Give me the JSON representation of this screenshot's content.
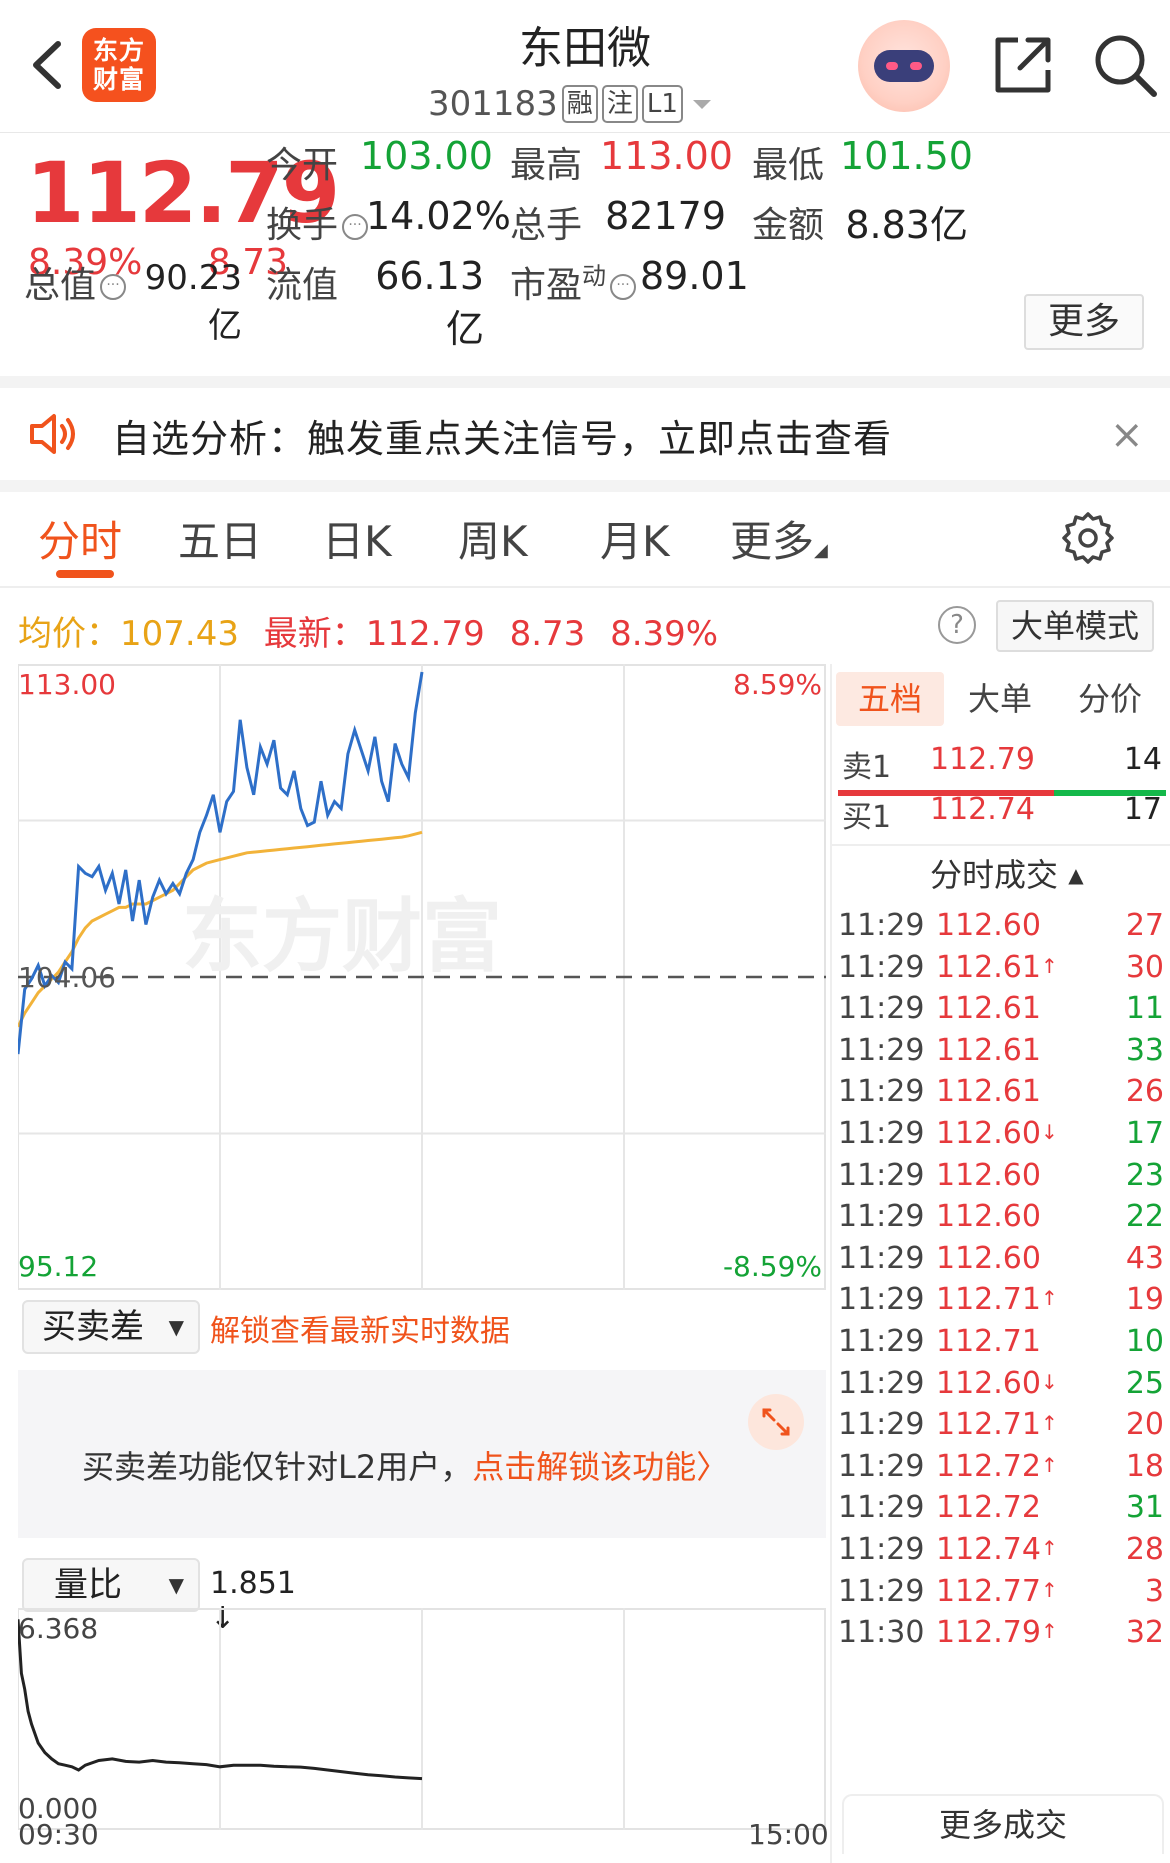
{
  "header": {
    "logo_text": "东方财富",
    "title": "东田微",
    "code": "301183",
    "tags": [
      "融",
      "注",
      "L1"
    ]
  },
  "quote": {
    "price": "112.79",
    "change_pct": "8.39%",
    "change": "8.73",
    "fields": {
      "open_label": "今开",
      "open_value": "103.00",
      "high_label": "最高",
      "high_value": "113.00",
      "low_label": "最低",
      "low_value": "101.50",
      "turnover_label": "换手",
      "turnover_value": "14.02%",
      "volume_label": "总手",
      "volume_value": "82179",
      "amount_label": "金额",
      "amount_value": "8.83亿",
      "mktcap_label": "总值",
      "mktcap_value": "90.23亿",
      "float_label": "流值",
      "float_value": "66.13亿",
      "pe_label": "市盈",
      "pe_sup": "动",
      "pe_value": "89.01"
    },
    "more_label": "更多"
  },
  "banner": {
    "text": "自选分析：触发重点关注信号，立即点击查看",
    "close": "×"
  },
  "tabs": [
    "分时",
    "五日",
    "日K",
    "周K",
    "月K",
    "更多"
  ],
  "active_tab": 0,
  "info_line": {
    "avg_label": "均价：",
    "avg_value": "107.43",
    "last_label": "最新：",
    "last_price": "112.79",
    "last_change": "8.73",
    "last_pct": "8.39%",
    "help": "?",
    "big_order_label": "大单模式"
  },
  "chart_data": [
    {
      "type": "line",
      "y_left_ticks": [
        "113.00",
        "104.06",
        "95.12"
      ],
      "y_right_ticks": [
        "8.59%",
        "-8.59%"
      ],
      "x_ticks": [
        "09:30",
        "15:00"
      ],
      "ylim": [
        95.12,
        113.0
      ],
      "prev_close": 104.06,
      "watermark": "东方财富",
      "x": [
        0,
        2,
        4,
        6,
        8,
        10,
        12,
        14,
        16,
        18,
        20,
        22,
        24,
        26,
        28,
        30,
        32,
        34,
        36,
        38,
        40,
        42,
        44,
        46,
        48,
        50,
        52,
        54,
        56,
        58,
        60,
        62,
        64,
        66,
        68,
        70,
        72,
        74,
        76,
        78,
        80,
        82,
        84,
        86,
        88,
        90,
        92,
        94,
        96,
        98,
        100,
        102,
        104,
        106,
        108,
        110,
        112,
        114,
        116,
        118,
        120
      ],
      "series": [
        {
          "name": "price",
          "color": "#2e6fc8",
          "values": [
            101.8,
            103.7,
            104.0,
            104.4,
            103.8,
            104.1,
            103.9,
            104.5,
            104.3,
            107.3,
            107.1,
            107.0,
            107.3,
            106.6,
            107.1,
            106.2,
            107.2,
            105.7,
            106.9,
            105.6,
            106.4,
            106.9,
            106.5,
            106.8,
            106.5,
            107.1,
            107.5,
            108.3,
            108.8,
            109.4,
            108.3,
            109.2,
            109.5,
            111.6,
            110.2,
            109.4,
            110.8,
            110.3,
            111.0,
            109.6,
            109.4,
            110.1,
            109.0,
            108.5,
            108.6,
            109.8,
            108.8,
            109.2,
            109.0,
            110.6,
            111.3,
            110.7,
            110.1,
            111.1,
            109.8,
            109.2,
            110.9,
            110.3,
            109.9,
            111.8,
            113.0
          ]
        },
        {
          "name": "average",
          "color": "#f2b33a",
          "values": [
            102.6,
            103.0,
            103.3,
            103.6,
            103.8,
            104.0,
            104.2,
            104.5,
            104.8,
            105.2,
            105.5,
            105.7,
            105.8,
            105.9,
            106.0,
            106.1,
            106.1,
            106.2,
            106.2,
            106.2,
            106.3,
            106.4,
            106.5,
            106.6,
            106.8,
            107.0,
            107.2,
            107.3,
            107.4,
            107.45,
            107.5,
            107.55,
            107.6,
            107.65,
            107.7,
            107.72,
            107.74,
            107.76,
            107.78,
            107.8,
            107.82,
            107.84,
            107.86,
            107.88,
            107.9,
            107.92,
            107.94,
            107.96,
            107.98,
            108.0,
            108.02,
            108.04,
            108.06,
            108.08,
            108.1,
            108.12,
            108.14,
            108.16,
            108.2,
            108.25,
            108.3
          ]
        }
      ],
      "total_minutes": 240
    },
    {
      "type": "line",
      "title": "量比",
      "y_ticks": [
        "6.368",
        "0.000"
      ],
      "ylim": [
        0,
        6.368
      ],
      "x": [
        0,
        1,
        2,
        3,
        4,
        6,
        8,
        10,
        12,
        14,
        16,
        18,
        20,
        24,
        28,
        32,
        36,
        40,
        44,
        48,
        52,
        56,
        60,
        64,
        68,
        72,
        76,
        80,
        84,
        88,
        92,
        96,
        100,
        104,
        108,
        112,
        116,
        120
      ],
      "series": [
        {
          "name": "ratio",
          "color": "#222222",
          "values": [
            6.2,
            4.5,
            4.0,
            3.3,
            2.9,
            2.3,
            2.0,
            1.8,
            1.65,
            1.6,
            1.55,
            1.45,
            1.6,
            1.75,
            1.8,
            1.72,
            1.7,
            1.75,
            1.7,
            1.68,
            1.65,
            1.62,
            1.55,
            1.6,
            1.6,
            1.6,
            1.57,
            1.55,
            1.54,
            1.5,
            1.45,
            1.4,
            1.35,
            1.3,
            1.27,
            1.23,
            1.2,
            1.18
          ]
        }
      ],
      "total_minutes": 240
    }
  ],
  "lower_panel": {
    "spread_select": "买卖差",
    "unlock_text": "解锁查看最新实时数据",
    "l2_text": "买卖差功能仅针对L2用户，",
    "l2_link": "点击解锁该功能",
    "ratio_select": "量比",
    "ratio_value": "1.851",
    "ratio_arrow": "↓"
  },
  "right_panel": {
    "tabs": [
      "五档",
      "大单",
      "分价"
    ],
    "ask": {
      "label": "卖1",
      "price": "112.79",
      "volume": "14"
    },
    "bid": {
      "label": "买1",
      "price": "112.74",
      "volume": "17"
    },
    "trades_header": "分时成交",
    "trades": [
      {
        "time": "11:29",
        "price": "112.60",
        "arrow": "",
        "volume": "27",
        "color": "red"
      },
      {
        "time": "11:29",
        "price": "112.61",
        "arrow": "↑",
        "volume": "30",
        "color": "red"
      },
      {
        "time": "11:29",
        "price": "112.61",
        "arrow": "",
        "volume": "11",
        "color": "green"
      },
      {
        "time": "11:29",
        "price": "112.61",
        "arrow": "",
        "volume": "33",
        "color": "green"
      },
      {
        "time": "11:29",
        "price": "112.61",
        "arrow": "",
        "volume": "26",
        "color": "red"
      },
      {
        "time": "11:29",
        "price": "112.60",
        "arrow": "↓",
        "volume": "17",
        "color": "green"
      },
      {
        "time": "11:29",
        "price": "112.60",
        "arrow": "",
        "volume": "23",
        "color": "green"
      },
      {
        "time": "11:29",
        "price": "112.60",
        "arrow": "",
        "volume": "22",
        "color": "green"
      },
      {
        "time": "11:29",
        "price": "112.60",
        "arrow": "",
        "volume": "43",
        "color": "red"
      },
      {
        "time": "11:29",
        "price": "112.71",
        "arrow": "↑",
        "volume": "19",
        "color": "red"
      },
      {
        "time": "11:29",
        "price": "112.71",
        "arrow": "",
        "volume": "10",
        "color": "green"
      },
      {
        "time": "11:29",
        "price": "112.60",
        "arrow": "↓",
        "volume": "25",
        "color": "green"
      },
      {
        "time": "11:29",
        "price": "112.71",
        "arrow": "↑",
        "volume": "20",
        "color": "red"
      },
      {
        "time": "11:29",
        "price": "112.72",
        "arrow": "↑",
        "volume": "18",
        "color": "red"
      },
      {
        "time": "11:29",
        "price": "112.72",
        "arrow": "",
        "volume": "31",
        "color": "green"
      },
      {
        "time": "11:29",
        "price": "112.74",
        "arrow": "↑",
        "volume": "28",
        "color": "red"
      },
      {
        "time": "11:29",
        "price": "112.77",
        "arrow": "↑",
        "volume": "3",
        "color": "red"
      },
      {
        "time": "11:30",
        "price": "112.79",
        "arrow": "↑",
        "volume": "32",
        "color": "red"
      }
    ],
    "more_trades": "更多成交"
  },
  "colors": {
    "up": "#e6393c",
    "down": "#14a336",
    "accent": "#f0531c",
    "avg": "#e8a316"
  }
}
